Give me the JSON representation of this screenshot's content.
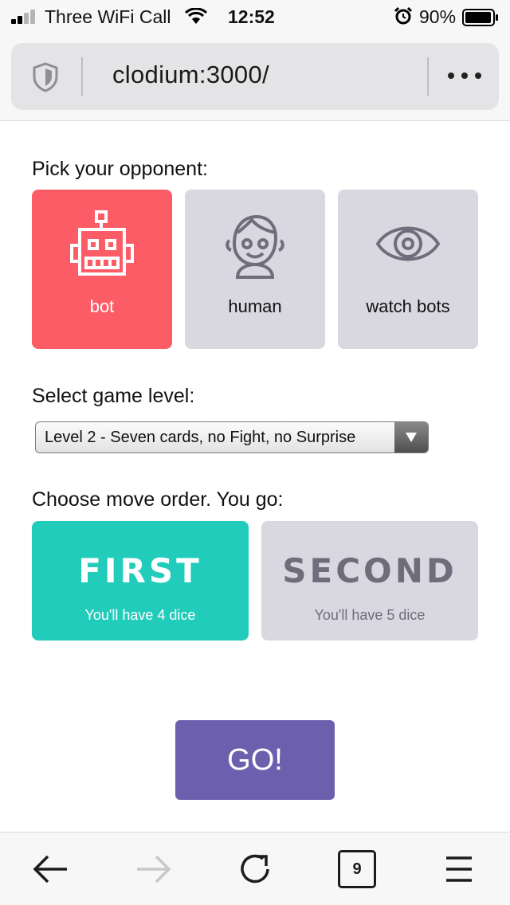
{
  "status_bar": {
    "carrier": "Three WiFi Call",
    "time": "12:52",
    "battery": "90%"
  },
  "browser": {
    "url": "clodium:3000/",
    "tab_count": "9"
  },
  "opponent": {
    "prompt": "Pick your opponent:",
    "options": [
      {
        "label": "bot",
        "icon": "robot-icon",
        "selected": true
      },
      {
        "label": "human",
        "icon": "human-face-icon",
        "selected": false
      },
      {
        "label": "watch bots",
        "icon": "eye-icon",
        "selected": false
      }
    ]
  },
  "level": {
    "prompt": "Select game level:",
    "selected": "Level 2 - Seven cards, no Fight, no Surprise"
  },
  "order": {
    "prompt": "Choose move order. You go:",
    "options": [
      {
        "title": "FIRST",
        "subtitle": "You'll have 4 dice",
        "selected": true
      },
      {
        "title": "SECOND",
        "subtitle": "You'll have 5 dice",
        "selected": false
      }
    ]
  },
  "go_label": "GO!",
  "colors": {
    "selected_opponent": "#fc5c65",
    "selected_order": "#21ccbb",
    "tile_default": "#d9d8e1",
    "go_button": "#6c5fae"
  }
}
